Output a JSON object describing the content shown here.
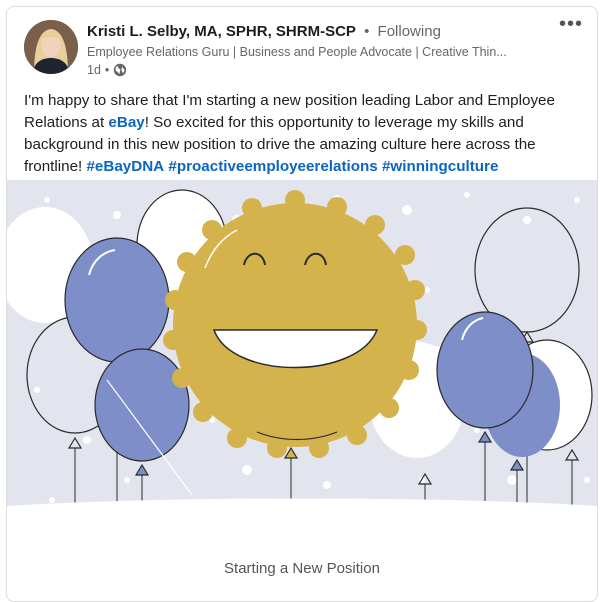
{
  "post": {
    "author": {
      "name": "Kristi L. Selby, MA, SPHR, SHRM-SCP",
      "separator": "•",
      "follow_status": "Following",
      "headline": "Employee Relations Guru | Business and People Advocate | Creative Thin...",
      "time_ago": "1d",
      "time_separator": "•",
      "visibility_icon": "globe-icon"
    },
    "more_label": "•••",
    "text": {
      "part1": "I'm happy to share that I'm starting a new position leading Labor and Employee Relations at ",
      "mention": "eBay",
      "part2": "! So excited for this opportunity to leverage my skills and background in this new position to drive the amazing culture here across the frontline! ",
      "hashtags": [
        "#eBayDNA",
        "#proactiveemployeerelations",
        "#winningculture"
      ]
    },
    "image": {
      "caption": "Starting a New Position",
      "colors": {
        "background": "#e3e5ee",
        "balloon_blue": "#7d8ec8",
        "smiley_gold": "#d4b24c"
      }
    }
  }
}
